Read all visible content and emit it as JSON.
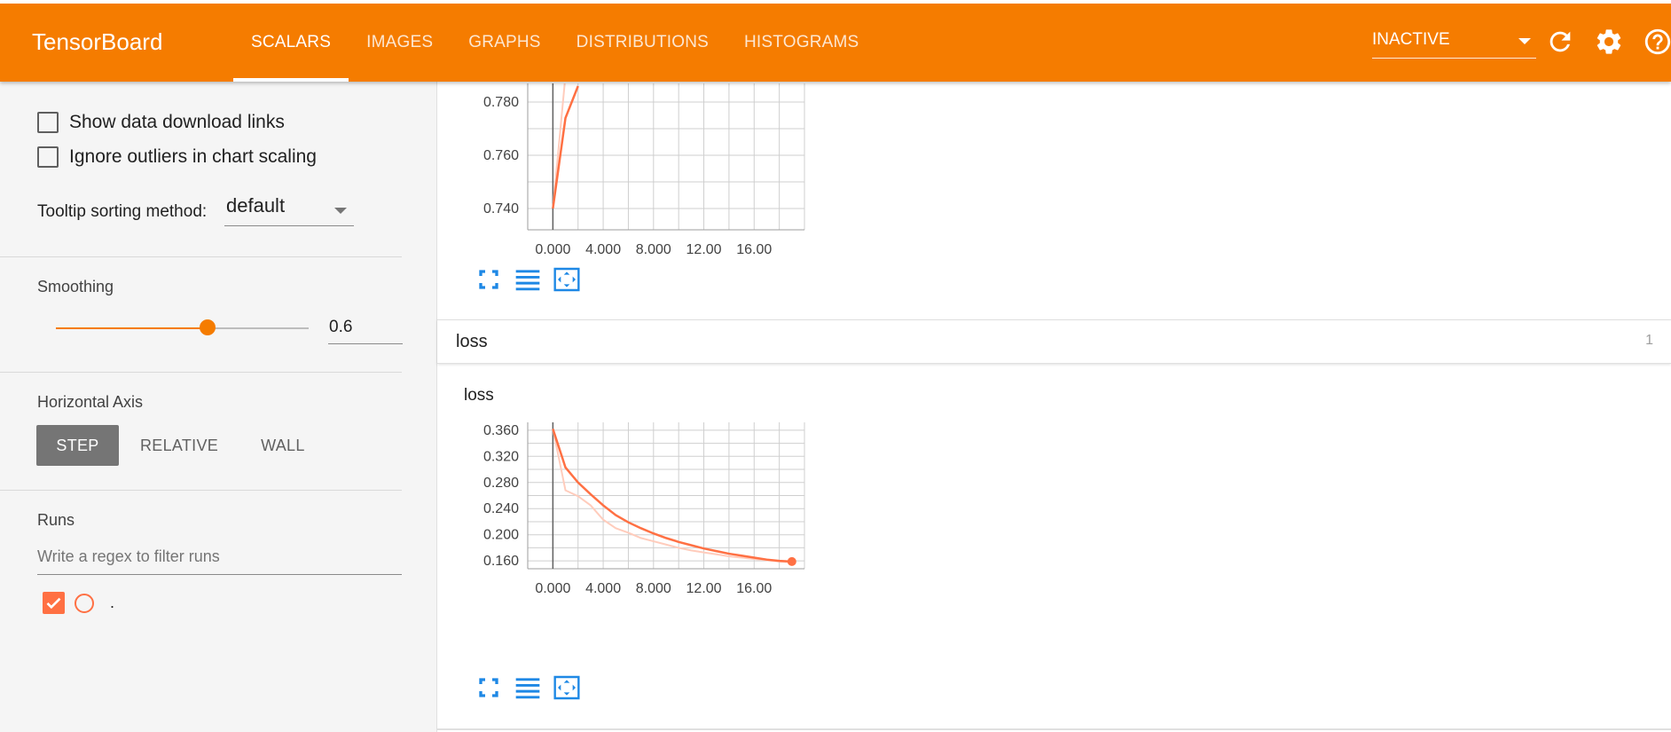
{
  "header": {
    "brand": "TensorBoard",
    "tabs": [
      {
        "label": "SCALARS",
        "active": true
      },
      {
        "label": "IMAGES",
        "active": false
      },
      {
        "label": "GRAPHS",
        "active": false
      },
      {
        "label": "DISTRIBUTIONS",
        "active": false
      },
      {
        "label": "HISTOGRAMS",
        "active": false
      }
    ],
    "run_status": "INACTIVE",
    "icons": [
      "refresh-icon",
      "settings-icon",
      "help-icon"
    ],
    "accent_color": "#f57c00"
  },
  "sidebar": {
    "show_download_links": {
      "label": "Show data download links",
      "checked": false
    },
    "ignore_outliers": {
      "label": "Ignore outliers in chart scaling",
      "checked": false
    },
    "tooltip_sorting": {
      "label": "Tooltip sorting method:",
      "value": "default"
    },
    "smoothing": {
      "label": "Smoothing",
      "value": "0.6",
      "fraction": 0.6
    },
    "horizontal_axis": {
      "label": "Horizontal Axis",
      "options": [
        {
          "label": "STEP",
          "active": true
        },
        {
          "label": "RELATIVE",
          "active": false
        },
        {
          "label": "WALL",
          "active": false
        }
      ]
    },
    "runs": {
      "label": "Runs",
      "filter_placeholder": "Write a regex to filter runs",
      "items": [
        {
          "name": ".",
          "checked": true,
          "color": "#ff7043"
        }
      ]
    }
  },
  "main": {
    "top_chart": {
      "y_ticks": [
        "0.780",
        "0.760",
        "0.740"
      ],
      "x_ticks": [
        "0.000",
        "4.000",
        "8.000",
        "12.00",
        "16.00"
      ]
    },
    "loss_group": {
      "name": "loss",
      "count": "1"
    },
    "loss_chart": {
      "title": "loss",
      "y_ticks": [
        "0.360",
        "0.320",
        "0.280",
        "0.240",
        "0.200",
        "0.160"
      ],
      "x_ticks": [
        "0.000",
        "4.000",
        "8.000",
        "12.00",
        "16.00"
      ]
    }
  },
  "chart_data": [
    {
      "type": "line",
      "title": "",
      "xlabel": "",
      "ylabel": "",
      "xlim": [
        -2,
        20
      ],
      "ylim": [
        0.732,
        0.787
      ],
      "grid": true,
      "series": [
        {
          "role": "smoothed",
          "color": "#ff7043",
          "x": [
            0,
            1,
            2
          ],
          "y": [
            0.74,
            0.774,
            0.786
          ]
        },
        {
          "role": "raw",
          "color": "#ffccbc",
          "x": [
            0,
            1,
            2
          ],
          "y": [
            0.74,
            0.79,
            0.8
          ]
        }
      ]
    },
    {
      "type": "line",
      "title": "loss",
      "xlabel": "",
      "ylabel": "",
      "xlim": [
        -2,
        20
      ],
      "ylim": [
        0.148,
        0.372
      ],
      "grid": true,
      "series": [
        {
          "role": "smoothed",
          "color": "#ff7043",
          "x": [
            0,
            1,
            2,
            3,
            4,
            5,
            6,
            7,
            8,
            9,
            10,
            11,
            12,
            13,
            14,
            15,
            16,
            17,
            18,
            19
          ],
          "y": [
            0.362,
            0.303,
            0.28,
            0.262,
            0.245,
            0.23,
            0.219,
            0.21,
            0.202,
            0.195,
            0.189,
            0.184,
            0.179,
            0.175,
            0.171,
            0.168,
            0.165,
            0.162,
            0.16,
            0.159
          ]
        },
        {
          "role": "raw",
          "color": "#ffccbc",
          "x": [
            0,
            1,
            2,
            3,
            4,
            5,
            6,
            7,
            8,
            9,
            10,
            11,
            12,
            13,
            14,
            15,
            16,
            17,
            18,
            19
          ],
          "y": [
            0.362,
            0.268,
            0.259,
            0.245,
            0.223,
            0.21,
            0.203,
            0.195,
            0.19,
            0.185,
            0.18,
            0.176,
            0.173,
            0.17,
            0.167,
            0.165,
            0.163,
            0.161,
            0.159,
            0.158
          ]
        }
      ]
    }
  ]
}
